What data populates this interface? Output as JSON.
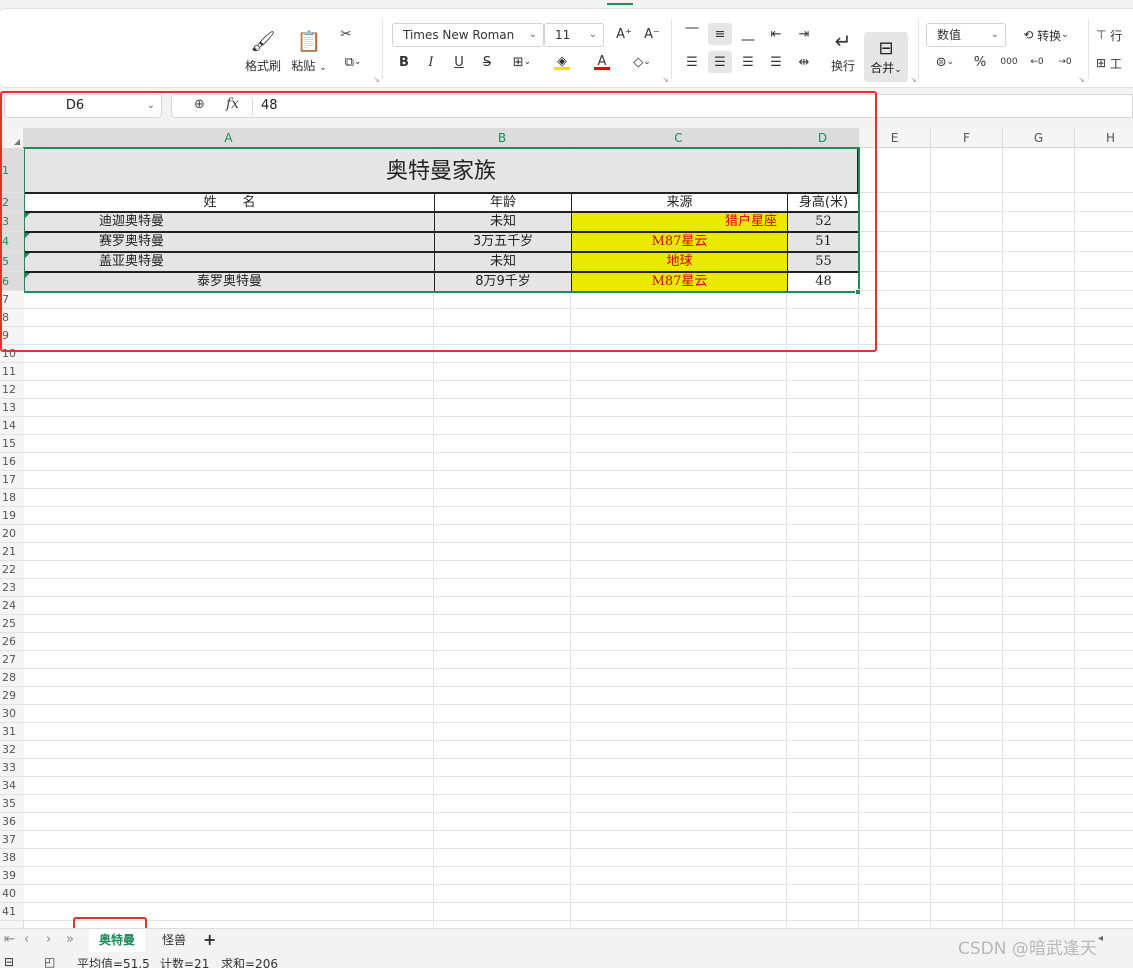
{
  "ribbon": {
    "format_painter": "格式刷",
    "paste": "粘贴",
    "font_name": "Times New Roman",
    "font_size": "11",
    "wrap": "换行",
    "merge": "合并",
    "number_format": "数值",
    "convert": "转换",
    "rows_cols_partial": "行",
    "worksheet_partial": "工",
    "bold": "B",
    "italic": "I",
    "underline": "U",
    "strike": "S",
    "percent": "%",
    "thousands": "000",
    "inc_font": "A⁺",
    "dec_font": "A⁻",
    "colors": {
      "font_color": "#e00000",
      "fill_color": "#f0e000",
      "accent": "#1f8a5a"
    }
  },
  "formula_bar": {
    "cell_ref": "D6",
    "fx_label": "fx",
    "value": "48"
  },
  "columns": [
    "A",
    "B",
    "C",
    "D",
    "E",
    "F",
    "G",
    "H"
  ],
  "rows": [
    "1",
    "2",
    "3",
    "4",
    "5",
    "6",
    "7",
    "8",
    "9",
    "10",
    "11",
    "12",
    "13",
    "14",
    "15",
    "16",
    "17",
    "18",
    "19",
    "20",
    "21",
    "22",
    "23",
    "24",
    "25",
    "26",
    "27",
    "28",
    "29",
    "30",
    "31",
    "32",
    "33",
    "34",
    "35",
    "36",
    "37",
    "38",
    "39",
    "40",
    "41"
  ],
  "table": {
    "title": "奥特曼家族",
    "headers": [
      "姓　　名",
      "年龄",
      "来源",
      "身高(米)"
    ],
    "rows": [
      {
        "name": "迪迦奥特曼",
        "age": "未知",
        "origin": "猎户星座",
        "height": "52"
      },
      {
        "name": "赛罗奥特曼",
        "age": "3万五千岁",
        "origin": "M87星云",
        "height": "51"
      },
      {
        "name": "盖亚奥特曼",
        "age": "未知",
        "origin": "地球",
        "height": "55"
      },
      {
        "name": "泰罗奥特曼",
        "age": "8万9千岁",
        "origin": "M87星云",
        "height": "48"
      }
    ]
  },
  "sheets": [
    {
      "label": "奥特曼",
      "active": true
    },
    {
      "label": "怪兽",
      "active": false
    }
  ],
  "add_sheet": "+",
  "status": {
    "average": "平均值=51.5",
    "count": "计数=21",
    "sum": "求和=206"
  },
  "watermark": "CSDN @暗武逢天"
}
